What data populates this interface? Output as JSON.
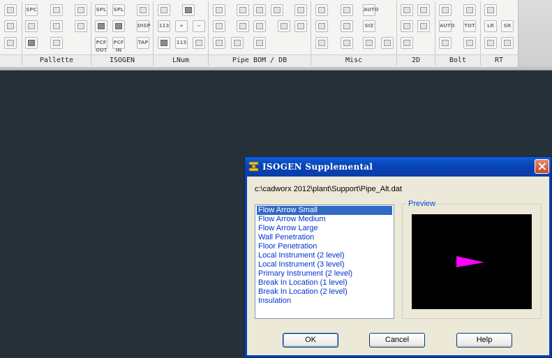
{
  "ribbon": {
    "panels": [
      "Pallette",
      "ISOGEN",
      "LNum",
      "Pipe BOM / DB",
      "Misc",
      "2D",
      "Bolt",
      "RT"
    ],
    "small_button_texts": {
      "spc": "SPC",
      "spl": "SPL",
      "disp": "DISP",
      "tap": "TAP",
      "num113": "113",
      "plus": "+",
      "minus": "−",
      "auto": "AUTO",
      "siz": "SIZ",
      "tot": "TOT",
      "lr": "LR",
      "sr": "SR",
      "pcf_out": "PCF OUT",
      "pcf_in": "PCF IN"
    }
  },
  "dialog": {
    "title": "ISOGEN Supplemental",
    "path": "c:\\cadworx 2012\\plant\\Support\\Pipe_Alt.dat",
    "list_items": [
      "Flow Arrow Small",
      "Flow Arrow Medium",
      "Flow Arrow Large",
      "Wall Penetration",
      "Floor Penetration",
      "Local Instrument (2 level)",
      "Local Instrument (3 level)",
      "Primary Instrument (2 level)",
      "Break In Location (1 level)",
      "Break In Location (2 level)",
      "Insulation"
    ],
    "selected_index": 0,
    "preview_label": "Preview",
    "preview_arrow_color": "#ff00ff",
    "buttons": {
      "ok": "OK",
      "cancel": "Cancel",
      "help": "Help"
    },
    "colors": {
      "titlebar": "#0a4fc8",
      "selection": "#316ac5",
      "list_text": "#0033cc"
    }
  }
}
